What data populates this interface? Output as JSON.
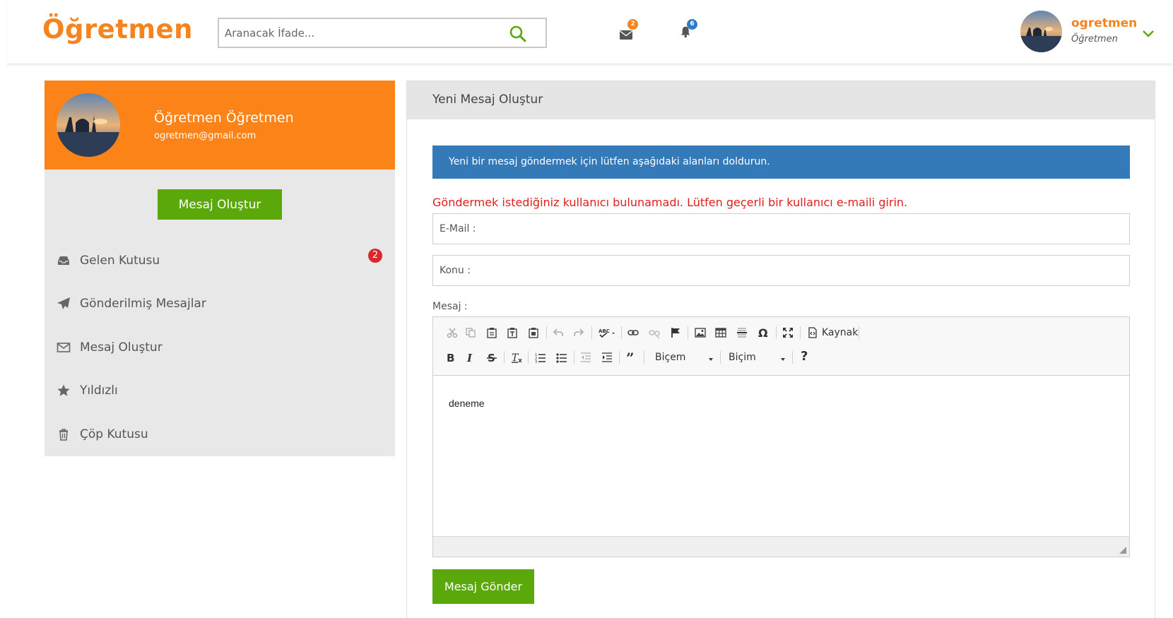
{
  "header": {
    "logo": "Öğretmen",
    "search_placeholder": "Aranacak İfade...",
    "messages_count": "2",
    "notifications_count": "6",
    "user_name": "ogretmen",
    "user_role": "Öğretmen",
    "colors": {
      "brand": "#f5841f",
      "msg_badge": "#f5841f",
      "notif_badge": "#2f7cc4"
    }
  },
  "sidebar": {
    "profile_name": "Öğretmen Öğretmen",
    "profile_email": "ogretmen@gmail.com",
    "compose_label": "Mesaj Oluştur",
    "items": [
      {
        "label": "Gelen Kutusu",
        "icon": "inbox-icon",
        "badge": "2"
      },
      {
        "label": "Gönderilmiş Mesajlar",
        "icon": "paper-plane-icon"
      },
      {
        "label": "Mesaj Oluştur",
        "icon": "envelope-icon"
      },
      {
        "label": "Yıldızlı",
        "icon": "star-icon"
      },
      {
        "label": "Çöp Kutusu",
        "icon": "trash-icon"
      }
    ],
    "colors": {
      "profile_bg": "#fb8317",
      "button": "#5aa80a",
      "badge": "#d9282a"
    }
  },
  "main": {
    "title": "Yeni Mesaj Oluştur",
    "info": "Yeni bir mesaj göndermek için lütfen aşağıdaki alanları doldurun.",
    "error": "Göndermek istediğiniz kullanıcı bulunamadı. Lütfen geçerli bir kullanıcı e-maili girin.",
    "email_label": "E-Mail :",
    "email_value": "",
    "subject_label": "Konu :",
    "subject_value": "",
    "message_label": "Mesaj :",
    "editor": {
      "source_label": "Kaynak",
      "styles_label": "Biçem",
      "format_label": "Biçim",
      "help_label": "?",
      "content": "deneme"
    },
    "send_label": "Mesaj Gönder",
    "colors": {
      "info_bg": "#347ab8",
      "error": "#e31c1c",
      "button": "#5aa80a"
    }
  }
}
